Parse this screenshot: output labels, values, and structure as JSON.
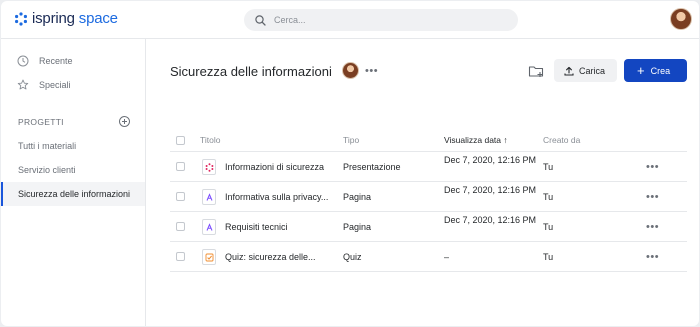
{
  "brand": {
    "name_part1": "ispring",
    "name_part2": " space",
    "accent": "#1d6be0"
  },
  "search": {
    "placeholder": "Cerca..."
  },
  "sidebar": {
    "nav": [
      {
        "label": "Recente",
        "icon": "clock-icon"
      },
      {
        "label": "Speciali",
        "icon": "star-icon"
      }
    ],
    "projects_label": "PROGETTI",
    "projects": [
      {
        "label": "Tutti i materiali",
        "active": false
      },
      {
        "label": "Servizio clienti",
        "active": false
      },
      {
        "label": "Sicurezza delle informazioni",
        "active": true
      }
    ]
  },
  "main": {
    "title": "Sicurezza delle informazioni",
    "more": "•••",
    "upload_label": "Carica",
    "create_label": "Crea",
    "create_plus": "+",
    "create_color": "#1346c1"
  },
  "table": {
    "columns": {
      "title": "Titolo",
      "type": "Tipo",
      "viewed": "Visualizza data ↑",
      "created": "Creato da"
    },
    "rows": [
      {
        "title": "Informazioni di sicurezza",
        "icon": "presentation-icon",
        "type": "Presentazione",
        "date": "Dec 7, 2020, 12:16 PM",
        "created": "Tu",
        "more": "•••"
      },
      {
        "title": "Informativa sulla privacy...",
        "icon": "page-icon",
        "type": "Pagina",
        "date": "Dec 7, 2020, 12:16 PM",
        "created": "Tu",
        "more": "•••"
      },
      {
        "title": "Requisiti tecnici",
        "icon": "page-icon",
        "type": "Pagina",
        "date": "Dec 7, 2020, 12:16 PM",
        "created": "Tu",
        "more": "•••"
      },
      {
        "title": "Quiz: sicurezza delle...",
        "icon": "quiz-icon",
        "type": "Quiz",
        "date": "–",
        "created": "Tu",
        "more": "•••"
      }
    ]
  }
}
